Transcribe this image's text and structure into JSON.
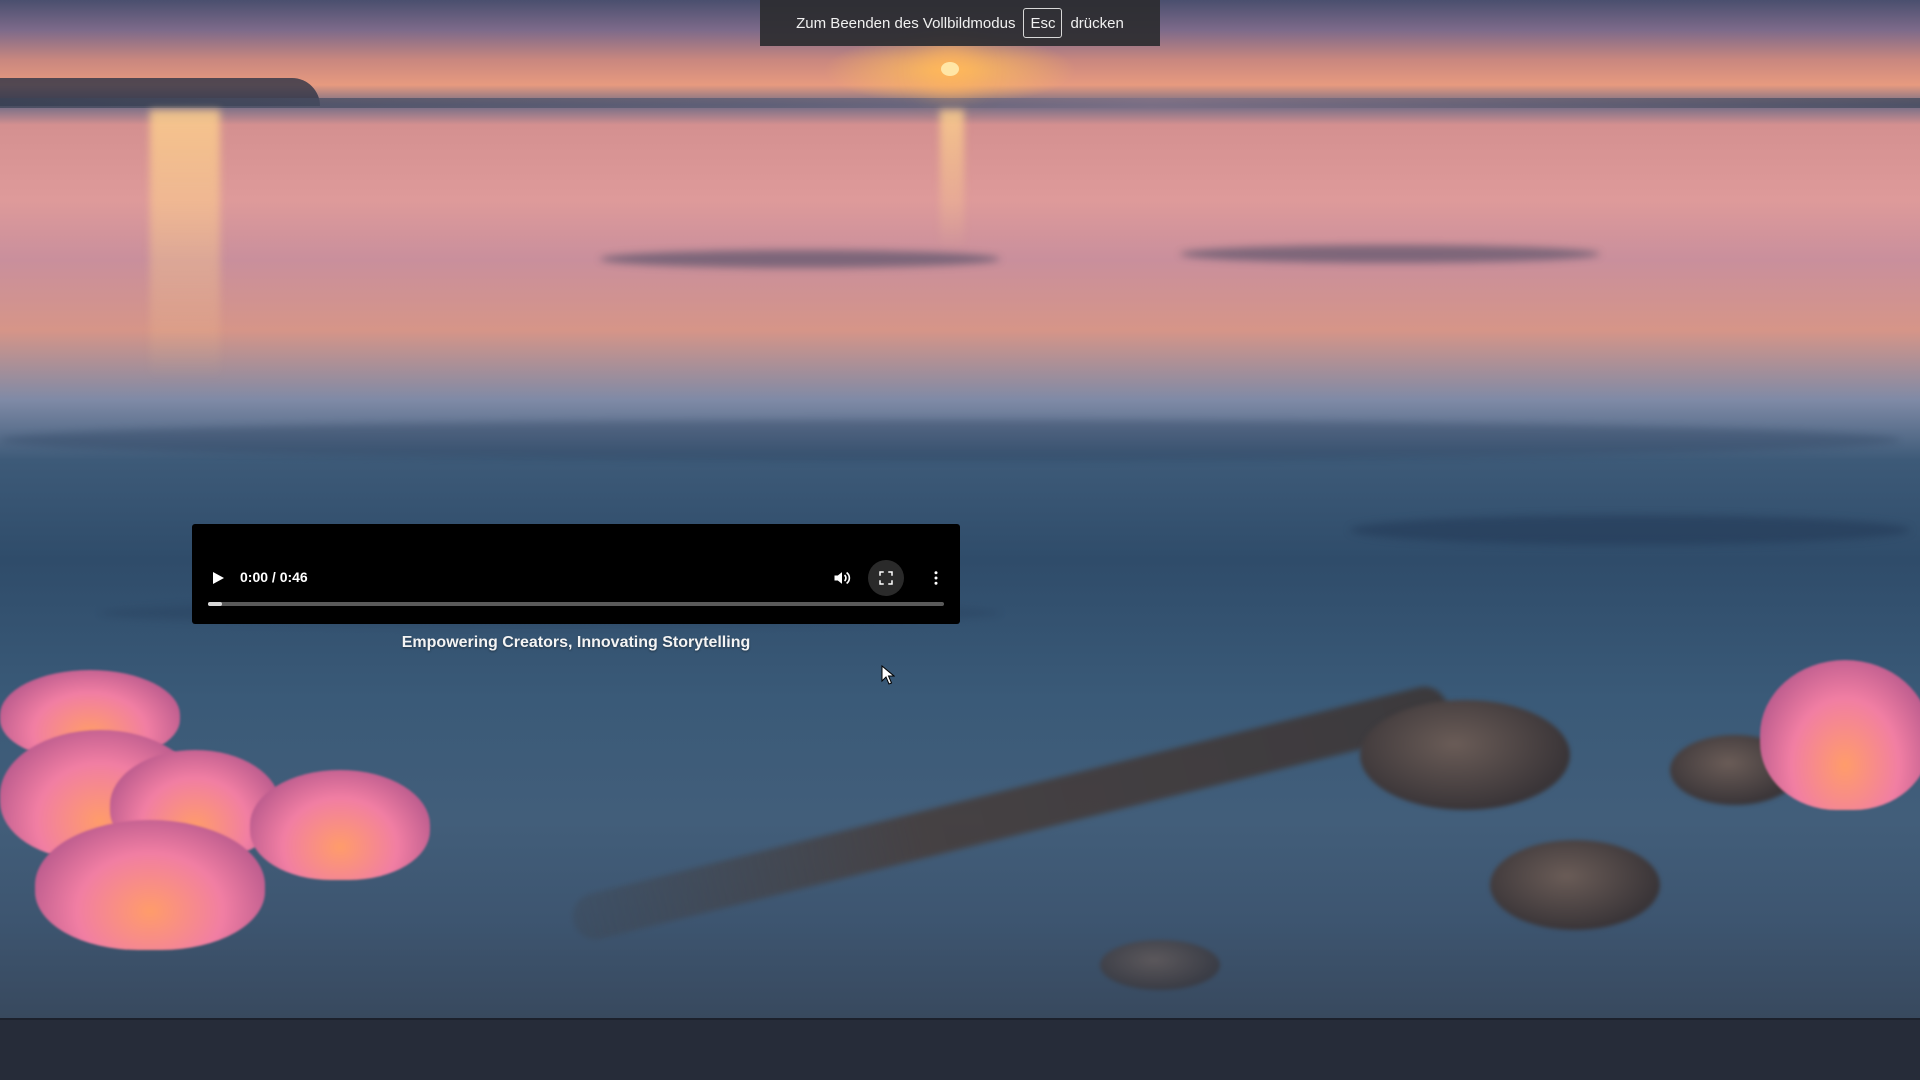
{
  "fullscreen_toast": {
    "before": "Zum Beenden des Vollbildmodus",
    "key": "Esc",
    "after": "drücken"
  },
  "player": {
    "time_display": "0:00 / 0:46",
    "progress": 0,
    "icons": {
      "play": "play-icon",
      "volume": "volume-icon",
      "fullscreen": "fullscreen-icon",
      "more": "more-vertical-icon"
    }
  },
  "caption": "Empowering Creators, Innovating Storytelling",
  "colors": {
    "player_bg": "#000000",
    "toast_bg": "#2d2d30",
    "bottom_bar": "#262c39"
  }
}
